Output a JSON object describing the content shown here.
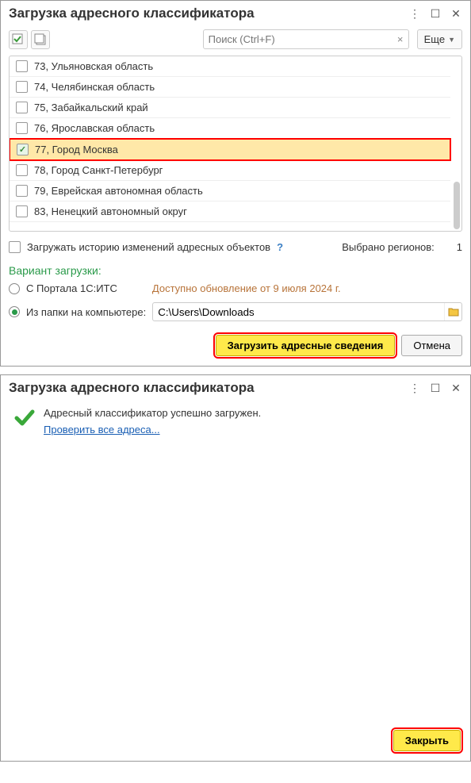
{
  "window1": {
    "title": "Загрузка адресного классификатора",
    "search": {
      "placeholder": "Поиск (Ctrl+F)"
    },
    "more_button": "Еще",
    "regions": [
      {
        "code": "73",
        "name": "73, Ульяновская область",
        "checked": false
      },
      {
        "code": "74",
        "name": "74, Челябинская область",
        "checked": false
      },
      {
        "code": "75",
        "name": "75, Забайкальский край",
        "checked": false
      },
      {
        "code": "76",
        "name": "76, Ярославская область",
        "checked": false
      },
      {
        "code": "77",
        "name": "77, Город Москва",
        "checked": true
      },
      {
        "code": "78",
        "name": "78, Город Санкт-Петербург",
        "checked": false
      },
      {
        "code": "79",
        "name": "79, Еврейская автономная область",
        "checked": false
      },
      {
        "code": "83",
        "name": "83, Ненецкий автономный округ",
        "checked": false
      }
    ],
    "history_checkbox_label": "Загружать историю изменений адресных объектов",
    "selected_label": "Выбрано регионов:",
    "selected_count": "1",
    "variant_label": "Вариант загрузки:",
    "radio_portal": "С Портала 1С:ИТС",
    "update_info": "Доступно обновление от 9 июля 2024 г.",
    "radio_folder": "Из папки на компьютере:",
    "folder_path": "C:\\Users\\Downloads",
    "btn_load": "Загрузить адресные сведения",
    "btn_cancel": "Отмена"
  },
  "window2": {
    "title": "Загрузка адресного классификатора",
    "success_msg": "Адресный классификатор успешно загружен.",
    "link_check": "Проверить все адреса...",
    "btn_close": "Закрыть"
  }
}
